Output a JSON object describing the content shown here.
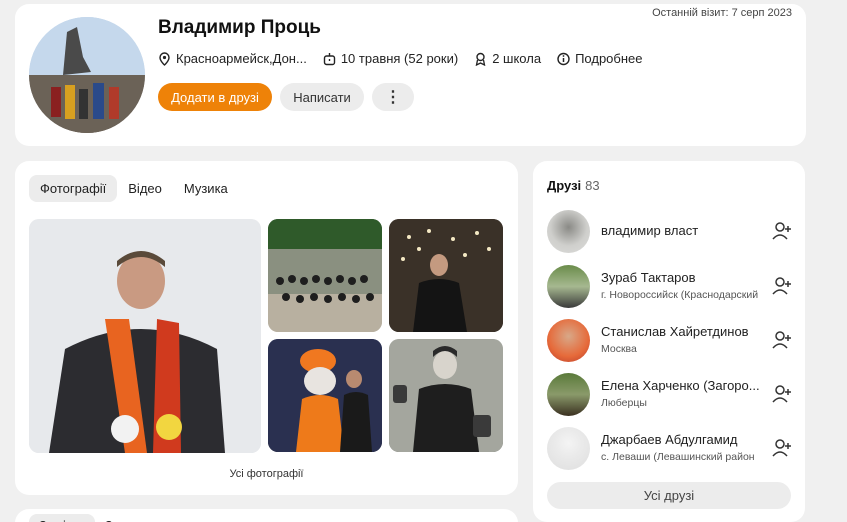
{
  "profile": {
    "name": "Владимир Проць",
    "last_visit": "Останній візит: 7 серп 2023",
    "location": "Красноармейск,Дон...",
    "birthday": "10 травня (52 роки)",
    "school": "2 школа",
    "more": "Подробнее",
    "actions": {
      "add_friend": "Додати в друзі",
      "message": "Написати",
      "more": "⋮"
    }
  },
  "media": {
    "tabs": [
      "Фотографії",
      "Відео",
      "Музика"
    ],
    "active_tab": "Фотографії",
    "all_photos": "Усі фотографії"
  },
  "friends": {
    "title": "Друзі",
    "count": "83",
    "items": [
      {
        "name": "владимир власт",
        "location": ""
      },
      {
        "name": "Зураб Тактаров",
        "location": "г. Новороссийск (Краснодарский"
      },
      {
        "name": "Станислав Хайретдинов",
        "location": "Москва"
      },
      {
        "name": "Елена Харченко (Загоро...",
        "location": "Люберцы"
      },
      {
        "name": "Джарбаев Абдулгамид",
        "location": "с. Леваши (Левашинский район"
      }
    ],
    "all_friends": "Усі друзі"
  },
  "bottom_tabs": [
    "Замітки",
    "Захоплення"
  ],
  "colors": {
    "accent": "#ee8208",
    "background": "#f0f0f0"
  }
}
